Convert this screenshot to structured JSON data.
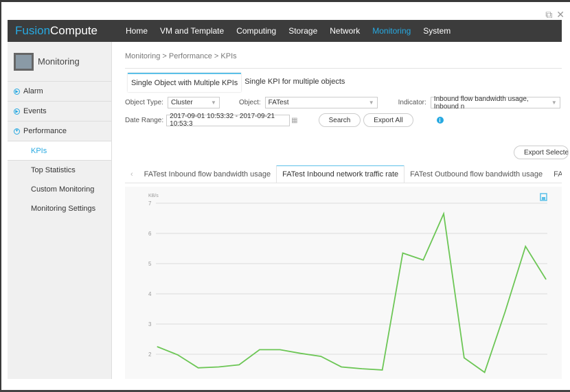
{
  "window": {
    "popout_icon": "external-link-icon",
    "close_icon": "close-icon"
  },
  "header": {
    "logo_part1": "Fusion",
    "logo_part2": "Compute",
    "nav": [
      "Home",
      "VM and Template",
      "Computing",
      "Storage",
      "Network",
      "Monitoring",
      "System"
    ],
    "active_nav": "Monitoring"
  },
  "sidebar": {
    "title": "Monitoring",
    "items": [
      "Alarm",
      "Events",
      "Performance"
    ],
    "sub_items": [
      "KPIs",
      "Top Statistics",
      "Custom Monitoring",
      "Monitoring Settings"
    ],
    "active_sub": "KPIs"
  },
  "main": {
    "breadcrumb": "Monitoring > Performance > KPIs",
    "tabs": [
      "Single Object with Multiple KPIs",
      "Single KPI for multiple objects"
    ],
    "object_type_label": "Object Type:",
    "object_type": "Cluster",
    "object_label": "Object:",
    "object": "FATest",
    "indicator_label": "Indicator:",
    "indicator": "Inbound flow bandwidth usage, Inbound n",
    "date_range_label": "Date Range:",
    "date_range": "2017-09-01 10:53:32 - 2017-09-21 10:53:3",
    "search": "Search",
    "export_all": "Export All",
    "export_selected": "Export Selecte",
    "kpi_tabs": [
      "FATest Inbound flow bandwidth usage",
      "FATest Inbound network traffic rate",
      "FATest Outbound flow bandwidth usage",
      "FATest C"
    ],
    "active_kpi_tab": 1
  },
  "accent": "#27a9e1",
  "line_color": "#6cc655",
  "chart_data": {
    "type": "line",
    "ylabel": "KB/s",
    "yticks": [
      2,
      3,
      4,
      5,
      6,
      7
    ],
    "ylim": [
      1.2,
      7
    ],
    "grid": true,
    "series": [
      {
        "values": [
          2.25,
          1.98,
          1.55,
          1.58,
          1.65,
          2.15,
          2.15,
          2.03,
          1.93,
          1.58,
          1.52,
          1.48,
          5.35,
          5.12,
          6.65,
          1.88,
          1.4,
          3.4,
          5.57,
          4.48
        ]
      }
    ]
  }
}
